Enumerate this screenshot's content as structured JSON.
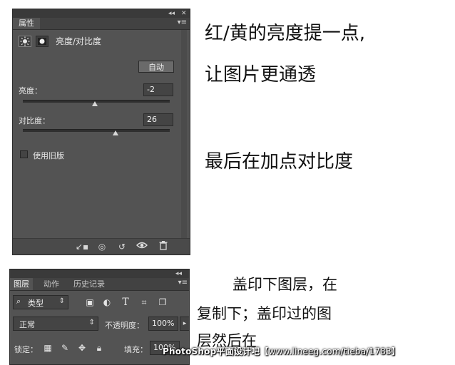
{
  "properties_panel": {
    "tab_label": "属性",
    "collapse_glyph": "◂◂",
    "close_glyph": "✕",
    "menu_glyph": "▾≡",
    "icons": [
      "brightness-sun-icon",
      "layer-mask-icon"
    ],
    "adjustment_title": "亮度/对比度",
    "auto_label": "自动",
    "brightness": {
      "label": "亮度：",
      "value": "-2",
      "slider_fraction": 0.49
    },
    "contrast": {
      "label": "对比度：",
      "value": "26",
      "slider_fraction": 0.63
    },
    "legacy_checkbox": {
      "label": "使用旧版",
      "checked": false
    },
    "bottom_icons": [
      "clip-to-layer-icon",
      "view-previous-icon",
      "reset-icon",
      "visibility-eye-icon",
      "trash-icon"
    ]
  },
  "layers_panel": {
    "collapse_glyph": "◂◂",
    "tabs": [
      {
        "label": "图层",
        "active": true
      },
      {
        "label": "动作",
        "active": false
      },
      {
        "label": "历史记录",
        "active": false
      }
    ],
    "menu_glyph": "▾≡",
    "filter": {
      "label": "类型",
      "icon": "search-icon"
    },
    "filter_icons": [
      "pixel-layer-filter-icon",
      "adjustment-layer-filter-icon",
      "type-layer-filter-icon",
      "shape-layer-filter-icon",
      "smart-object-filter-icon"
    ],
    "blend_mode": "正常",
    "opacity_label": "不透明度：",
    "opacity_value": "100%",
    "lock_label": "锁定：",
    "lock_icons": [
      "lock-transparent-icon",
      "lock-image-icon",
      "lock-position-icon",
      "lock-all-icon"
    ],
    "fill_label": "填充：",
    "fill_value": "100%"
  },
  "notes": {
    "line1": "红/黄的亮度提一点,",
    "line2": "让图片更通透",
    "line3": "最后在加点对比度",
    "line4": "盖印下图层，在",
    "line5": "复制下；盖印过的图",
    "line6": "层然后在"
  },
  "watermark": {
    "brand": "PhotoShop平面设计吧",
    "url": "【www.lineeg.com/tieba/1783】"
  },
  "colors": {
    "panel_bg": "#535353",
    "panel_dark": "#3a3a3a",
    "field_bg": "#444444",
    "text_light": "#e6e6e6"
  }
}
